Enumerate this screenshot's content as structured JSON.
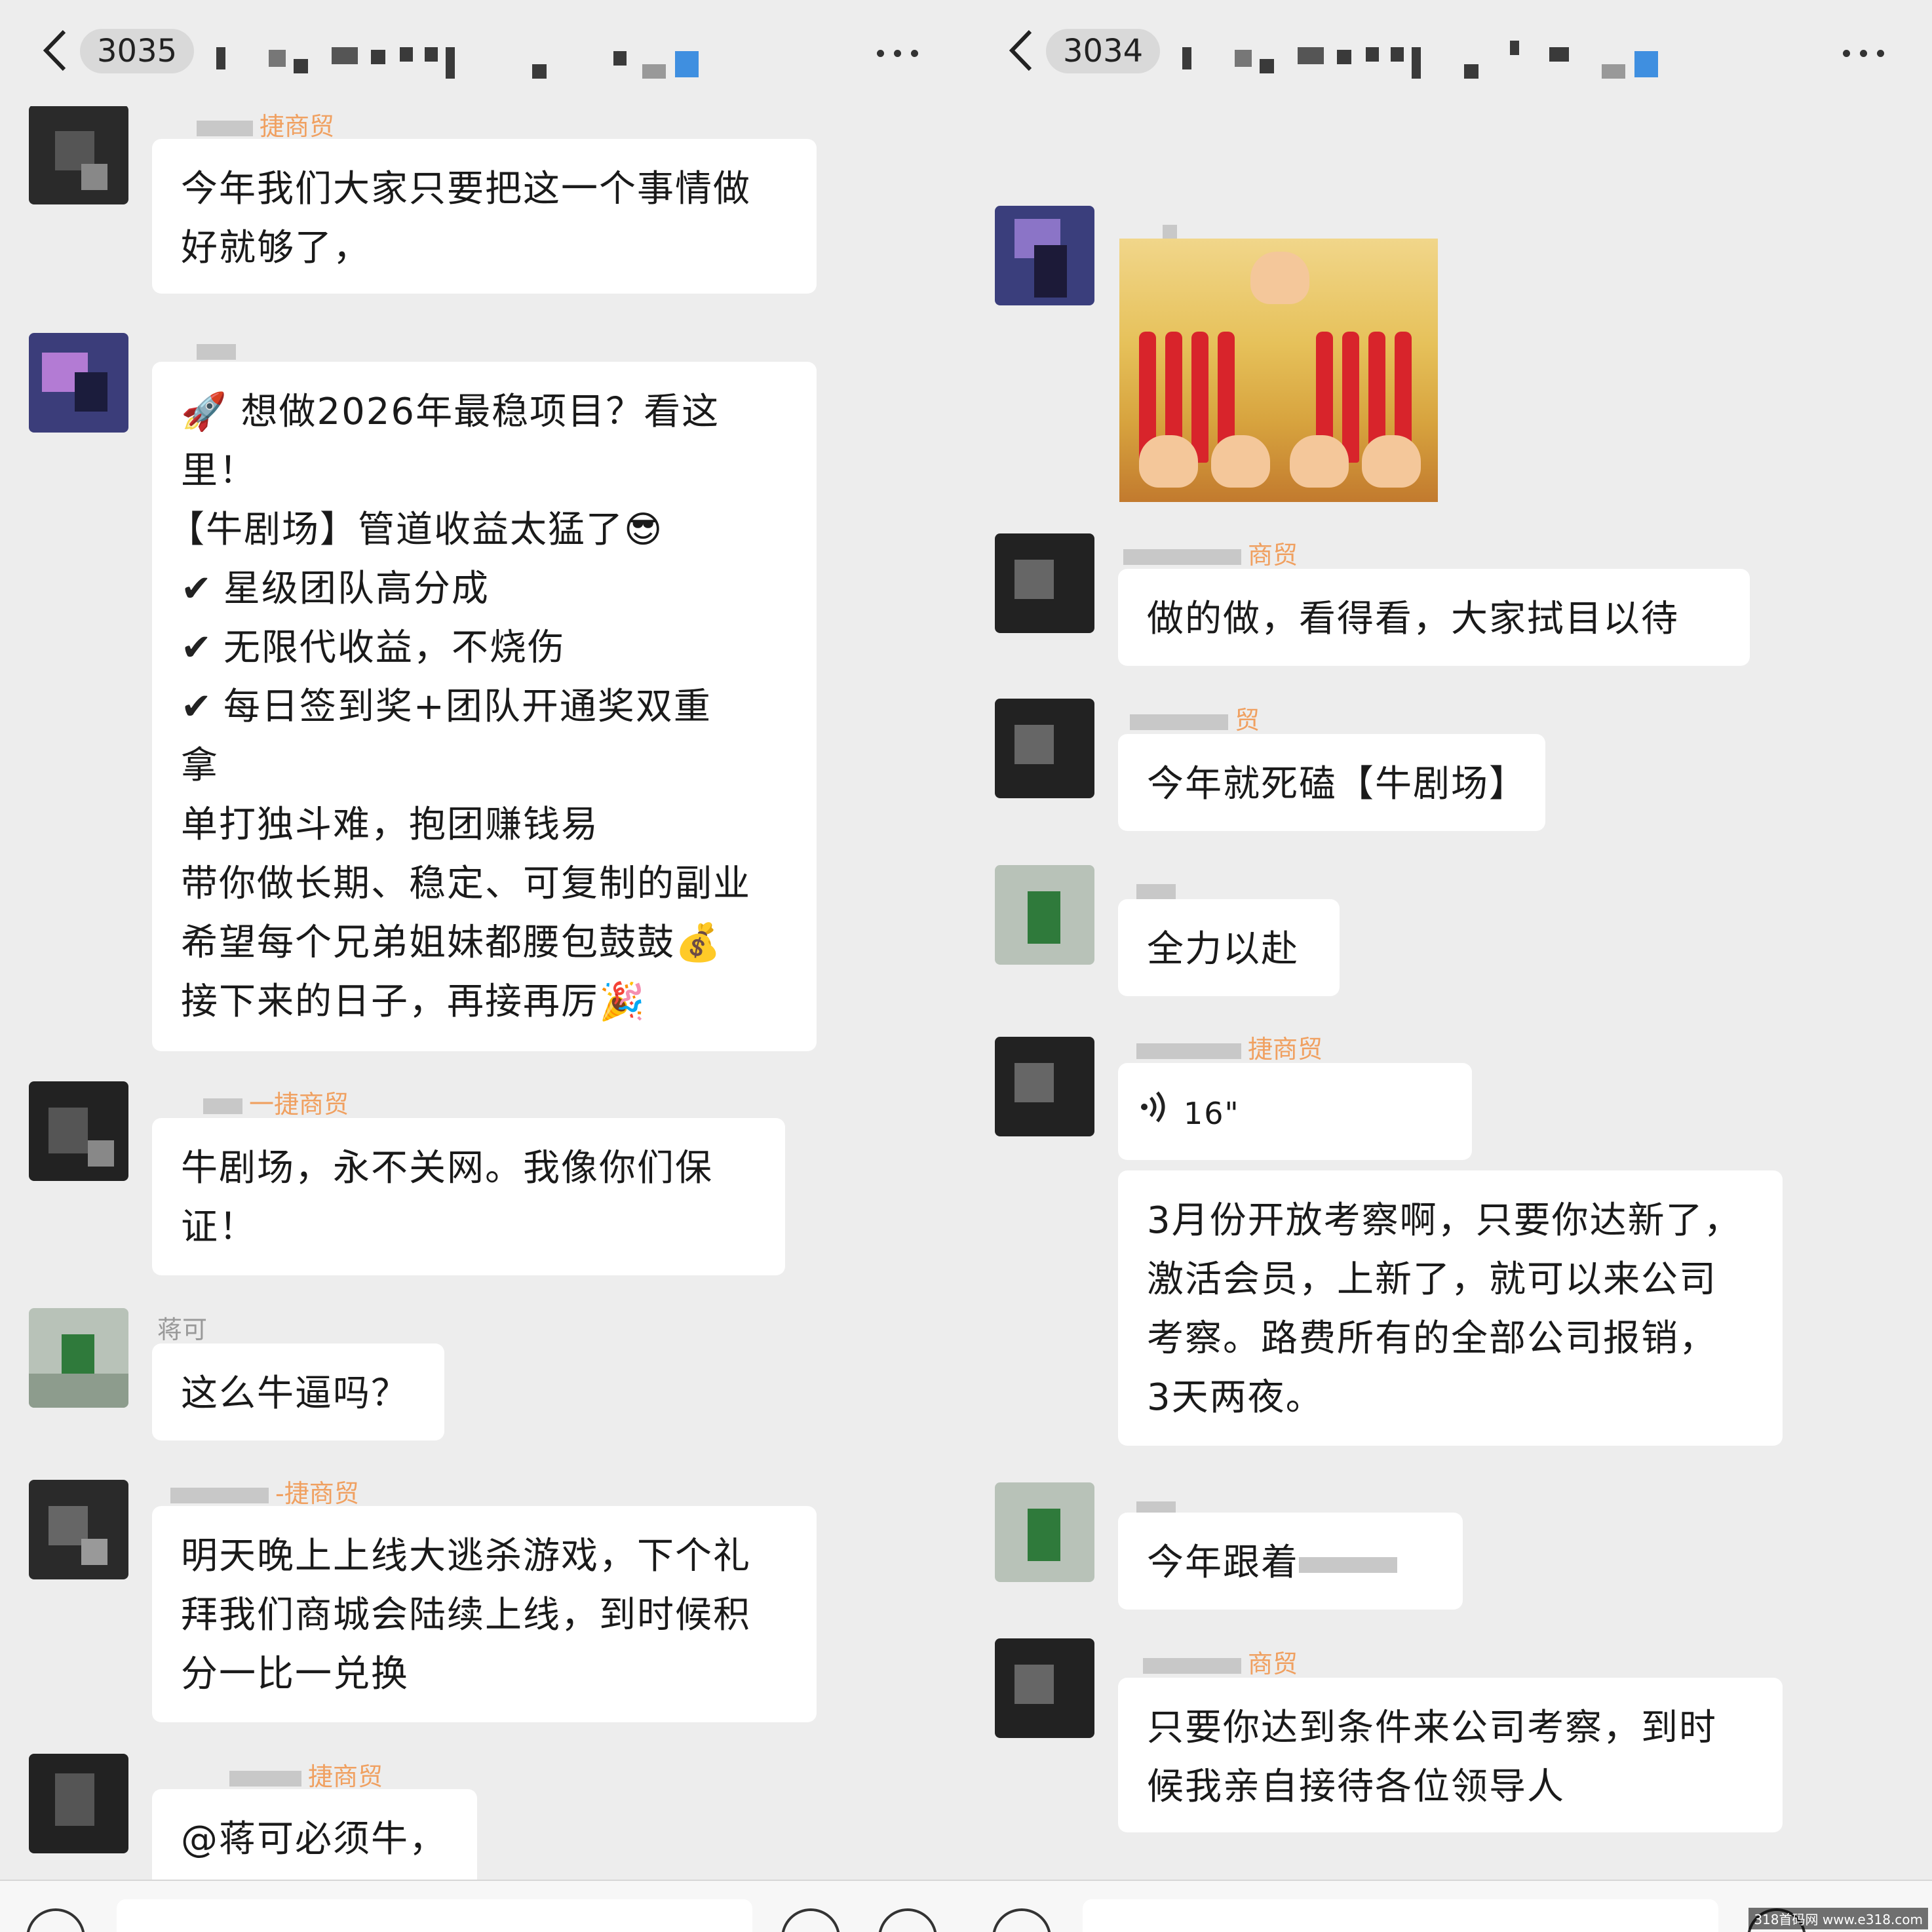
{
  "left": {
    "badge": "3035",
    "messages": {
      "m1": {
        "sender": "捷商贸",
        "lines": [
          "今年我们大家只要把这一个事情做",
          "好就够了，"
        ]
      },
      "m2": {
        "lines": [
          "想做2026年最稳项目？看这",
          "里！",
          "【牛剧场】管道收益太猛了",
          "星级团队高分成",
          "无限代收益，不烧伤",
          "每日签到奖+团队开通奖双重",
          "拿",
          " 单打独斗难，抱团赚钱易",
          "带你做长期、稳定、可复制的副业",
          "希望每个兄弟姐妹都腰包鼓鼓",
          "接下来的日子，再接再厉"
        ]
      },
      "m3": {
        "sender": "一捷商贸",
        "lines": [
          "牛剧场，永不关网。我像你们保",
          "证！"
        ]
      },
      "m4": {
        "sender": "蒋可",
        "lines": [
          "这么牛逼吗？"
        ]
      },
      "m5": {
        "sender": "-捷商贸",
        "lines": [
          "明天晚上上线大逃杀游戏，下个礼",
          "拜我们商城会陆续上线，到时候积",
          "分一比一兑换"
        ]
      },
      "m6": {
        "sender": "捷商贸",
        "lines": [
          "@蒋可必须牛，"
        ]
      }
    },
    "emoji": {
      "rocket": "🚀",
      "cool": "😎",
      "check": "✔",
      "moneybag": "💰",
      "party": "🎉"
    }
  },
  "right": {
    "badge": "3034",
    "messages": {
      "r1": {
        "sender": "商贸",
        "lines": [
          "做的做，看得看，大家拭目以待"
        ]
      },
      "r2": {
        "sender": "贸",
        "lines": [
          "今年就死磕【牛剧场】"
        ]
      },
      "r3": {
        "lines": [
          "全力以赴"
        ]
      },
      "r4": {
        "sender": "捷商贸",
        "voice": "16\"",
        "lines": [
          "3月份开放考察啊，只要你达新了，",
          "激活会员，上新了，就可以来公司",
          "考察。路费所有的全部公司报销，",
          "3天两夜。"
        ]
      },
      "r5": {
        "lines": [
          "今年跟着"
        ]
      },
      "r6": {
        "sender": "商贸",
        "lines": [
          "只要你达到条件来公司考察，到时",
          "候我亲自接待各位领导人"
        ]
      }
    }
  },
  "watermark": "318首码网 www.e318.com",
  "colors": {
    "background": "#ededed",
    "bubble": "#ffffff",
    "sender_org": "#f0a060",
    "sender_name": "#999999"
  },
  "icons": {
    "back": "chevron-left-icon",
    "more": "more-dots-icon",
    "voice": "voice-wave-icon"
  }
}
